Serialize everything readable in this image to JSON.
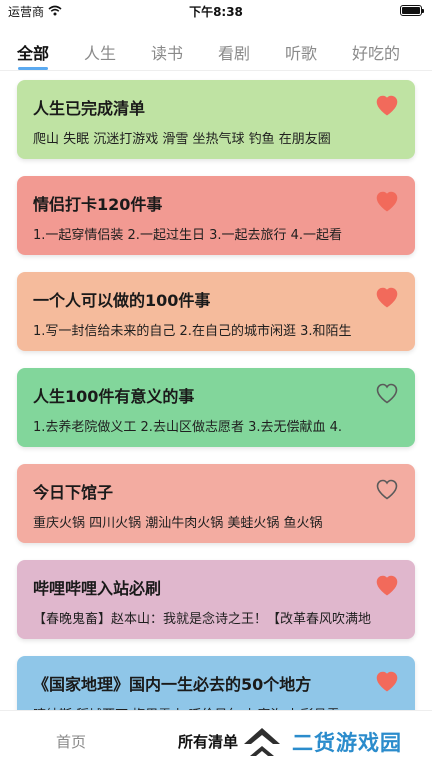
{
  "status_bar": {
    "carrier": "运营商",
    "time": "下午8:38"
  },
  "tabs": [
    {
      "label": "全部",
      "active": true
    },
    {
      "label": "人生"
    },
    {
      "label": "读书"
    },
    {
      "label": "看剧"
    },
    {
      "label": "听歌"
    },
    {
      "label": "好吃的"
    }
  ],
  "cards": [
    {
      "title": "人生已完成清单",
      "desc": "爬山  失眠  沉迷打游戏  滑雪  坐热气球  钓鱼  在朋友圈",
      "favorited": true,
      "color": "#bfe3a3"
    },
    {
      "title": "情侣打卡120件事",
      "desc": "1.一起穿情侣装  2.一起过生日  3.一起去旅行  4.一起看",
      "favorited": true,
      "color": "#f29a92"
    },
    {
      "title": "一个人可以做的100件事",
      "desc": "1.写一封信给未来的自己  2.在自己的城市闲逛  3.和陌生",
      "favorited": true,
      "color": "#f5bb9c"
    },
    {
      "title": "人生100件有意义的事",
      "desc": "1.去养老院做义工  2.去山区做志愿者  3.去无偿献血  4.",
      "favorited": false,
      "color": "#82d69b"
    },
    {
      "title": "今日下馆子",
      "desc": "重庆火锅  四川火锅  潮汕牛肉火锅  美蛙火锅  鱼火锅",
      "favorited": false,
      "color": "#f3aca1"
    },
    {
      "title": "哔哩哔哩入站必刷",
      "desc": "【春晚鬼畜】赵本山：我就是念诗之王！【改革春风吹满地",
      "favorited": true,
      "color": "#e0b7cd"
    },
    {
      "title": "《国家地理》国内一生必去的50个地方",
      "desc": "喀纳斯  稻城亚丁  梅里雪山  呼伦贝尔  九寨沟  七彩丹霞",
      "favorited": true,
      "color": "#8fc6e8"
    }
  ],
  "bottom_nav": {
    "home": "首页",
    "all": "所有清单"
  },
  "watermark": {
    "text": "二货游戏园"
  },
  "colors": {
    "heart_filled": "#f26a5b",
    "heart_outline": "#5a5a5a",
    "accent": "#5aa9f0",
    "watermark": "#2b8ccc"
  }
}
